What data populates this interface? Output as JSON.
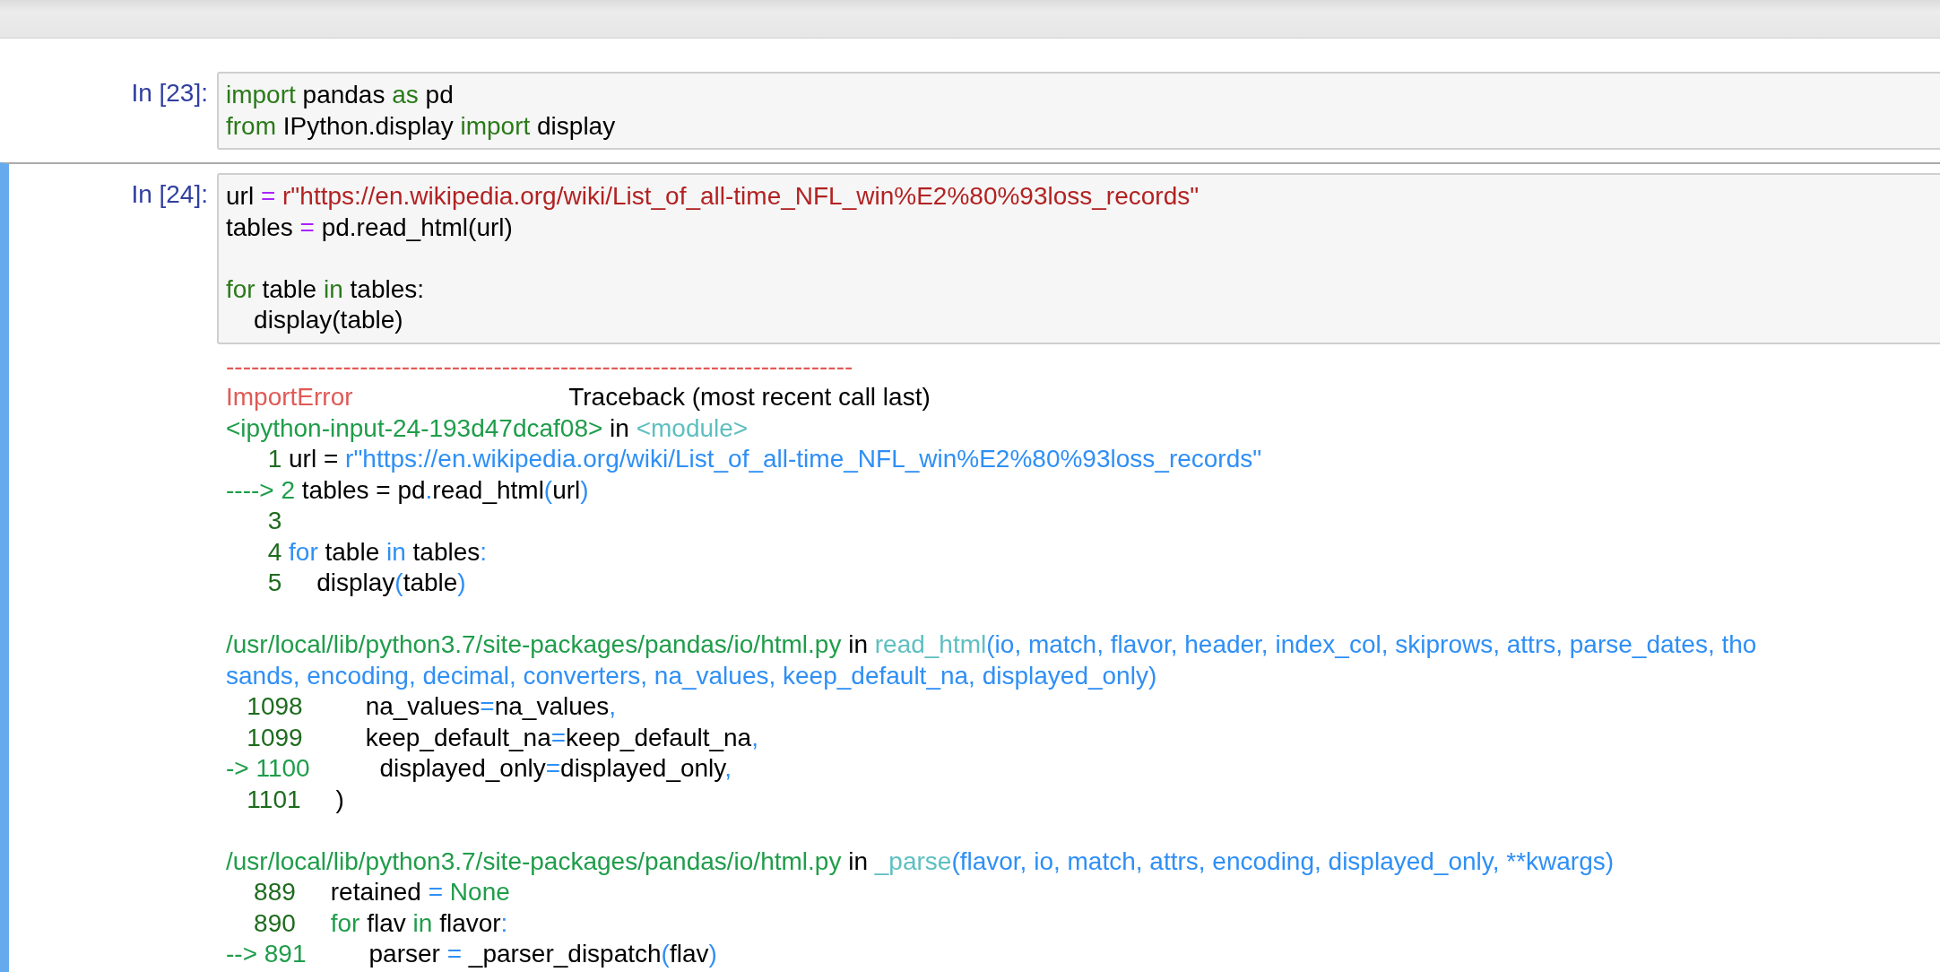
{
  "cells": [
    {
      "prompt": "In [23]:",
      "selected": false,
      "input": [
        {
          "tokens": [
            {
              "text": "import",
              "kind": "kw"
            },
            {
              "text": " pandas ",
              "kind": "plain"
            },
            {
              "text": "as",
              "kind": "kw"
            },
            {
              "text": " pd",
              "kind": "plain"
            }
          ]
        },
        {
          "tokens": [
            {
              "text": "from",
              "kind": "kw"
            },
            {
              "text": " IPython.display ",
              "kind": "plain"
            },
            {
              "text": "import",
              "kind": "kw"
            },
            {
              "text": " display",
              "kind": "plain"
            }
          ]
        }
      ]
    },
    {
      "prompt": "In [24]:",
      "selected": true,
      "input": [
        {
          "tokens": [
            {
              "text": "url ",
              "kind": "plain"
            },
            {
              "text": "=",
              "kind": "op"
            },
            {
              "text": " r\"https://en.wikipedia.org/wiki/List_of_all-time_NFL_win%E2%80%93loss_records\"",
              "kind": "str"
            }
          ]
        },
        {
          "tokens": [
            {
              "text": "tables ",
              "kind": "plain"
            },
            {
              "text": "=",
              "kind": "op"
            },
            {
              "text": " pd.read_html(url)",
              "kind": "plain"
            }
          ]
        },
        {
          "blank_before": true,
          "tokens": [
            {
              "text": "for",
              "kind": "kw"
            },
            {
              "text": " table ",
              "kind": "plain"
            },
            {
              "text": "in",
              "kind": "kw"
            },
            {
              "text": " tables:",
              "kind": "plain"
            }
          ]
        },
        {
          "tokens": [
            {
              "text": "    display(table)",
              "kind": "plain"
            }
          ]
        }
      ],
      "output": [
        {
          "tokens": [
            {
              "text": "---------------------------------------------------------------------------",
              "kind": "err"
            }
          ]
        },
        {
          "tokens": [
            {
              "text": "ImportError",
              "kind": "err"
            },
            {
              "text": "                               Traceback (most recent call last)",
              "kind": "plain"
            }
          ]
        },
        {
          "tokens": [
            {
              "text": "<ipython-input-24-193d47dcaf08>",
              "kind": "path"
            },
            {
              "text": " in ",
              "kind": "plain"
            },
            {
              "text": "<module>",
              "kind": "fn"
            }
          ]
        },
        {
          "tokens": [
            {
              "text": "      1",
              "kind": "num"
            },
            {
              "text": " url = ",
              "kind": "plain"
            },
            {
              "text": "r\"https://en.wikipedia.org/wiki/List_of_all-time_NFL_win%E2%80%93loss_records\"",
              "kind": "arg"
            }
          ]
        },
        {
          "tokens": [
            {
              "text": "----> 2",
              "kind": "path"
            },
            {
              "text": " tables = pd",
              "kind": "plain"
            },
            {
              "text": ".",
              "kind": "arg"
            },
            {
              "text": "read_html",
              "kind": "plain"
            },
            {
              "text": "(",
              "kind": "arg"
            },
            {
              "text": "url",
              "kind": "plain"
            },
            {
              "text": ")",
              "kind": "arg"
            }
          ]
        },
        {
          "tokens": [
            {
              "text": "      3",
              "kind": "num"
            }
          ]
        },
        {
          "tokens": [
            {
              "text": "      4",
              "kind": "num"
            },
            {
              "text": " for",
              "kind": "arg"
            },
            {
              "text": " table ",
              "kind": "plain"
            },
            {
              "text": "in",
              "kind": "arg"
            },
            {
              "text": " tables",
              "kind": "plain"
            },
            {
              "text": ":",
              "kind": "arg"
            }
          ]
        },
        {
          "tokens": [
            {
              "text": "      5",
              "kind": "num"
            },
            {
              "text": "     display",
              "kind": "plain"
            },
            {
              "text": "(",
              "kind": "arg"
            },
            {
              "text": "table",
              "kind": "plain"
            },
            {
              "text": ")",
              "kind": "arg"
            }
          ]
        },
        {
          "blank_before": true,
          "tokens": [
            {
              "text": "/usr/local/lib/python3.7/site-packages/pandas/io/html.py",
              "kind": "path"
            },
            {
              "text": " in ",
              "kind": "plain"
            },
            {
              "text": "read_html",
              "kind": "fn"
            },
            {
              "text": "(io, match, flavor, header, index_col, skiprows, attrs, parse_dates, tho",
              "kind": "arg"
            }
          ]
        },
        {
          "tokens": [
            {
              "text": "sands, encoding, decimal, converters, na_values, keep_default_na, displayed_only)",
              "kind": "arg"
            }
          ]
        },
        {
          "tokens": [
            {
              "text": "   1098",
              "kind": "num"
            },
            {
              "text": "         na_values",
              "kind": "plain"
            },
            {
              "text": "=",
              "kind": "arg"
            },
            {
              "text": "na_values",
              "kind": "plain"
            },
            {
              "text": ",",
              "kind": "arg"
            }
          ]
        },
        {
          "tokens": [
            {
              "text": "   1099",
              "kind": "num"
            },
            {
              "text": "         keep_default_na",
              "kind": "plain"
            },
            {
              "text": "=",
              "kind": "arg"
            },
            {
              "text": "keep_default_na",
              "kind": "plain"
            },
            {
              "text": ",",
              "kind": "arg"
            }
          ]
        },
        {
          "tokens": [
            {
              "text": "-> 1100",
              "kind": "path"
            },
            {
              "text": "          displayed_only",
              "kind": "plain"
            },
            {
              "text": "=",
              "kind": "arg"
            },
            {
              "text": "displayed_only",
              "kind": "plain"
            },
            {
              "text": ",",
              "kind": "arg"
            }
          ]
        },
        {
          "tokens": [
            {
              "text": "   1101",
              "kind": "num"
            },
            {
              "text": "     )",
              "kind": "plain"
            }
          ]
        },
        {
          "blank_before": true,
          "tokens": [
            {
              "text": "/usr/local/lib/python3.7/site-packages/pandas/io/html.py",
              "kind": "path"
            },
            {
              "text": " in ",
              "kind": "plain"
            },
            {
              "text": "_parse",
              "kind": "fn"
            },
            {
              "text": "(flavor, io, match, attrs, encoding, displayed_only, **kwargs)",
              "kind": "arg"
            }
          ]
        },
        {
          "tokens": [
            {
              "text": "    889",
              "kind": "num"
            },
            {
              "text": "     retained ",
              "kind": "plain"
            },
            {
              "text": "=",
              "kind": "arg"
            },
            {
              "text": " None",
              "kind": "path"
            }
          ]
        },
        {
          "tokens": [
            {
              "text": "    890",
              "kind": "num"
            },
            {
              "text": "     for",
              "kind": "path"
            },
            {
              "text": " flav ",
              "kind": "plain"
            },
            {
              "text": "in",
              "kind": "path"
            },
            {
              "text": " flavor",
              "kind": "plain"
            },
            {
              "text": ":",
              "kind": "arg"
            }
          ]
        },
        {
          "tokens": [
            {
              "text": "--> 891",
              "kind": "path"
            },
            {
              "text": "         parser ",
              "kind": "plain"
            },
            {
              "text": "=",
              "kind": "arg"
            },
            {
              "text": " _parser_dispatch",
              "kind": "plain"
            },
            {
              "text": "(",
              "kind": "arg"
            },
            {
              "text": "flav",
              "kind": "plain"
            },
            {
              "text": ")",
              "kind": "arg"
            }
          ]
        }
      ]
    }
  ]
}
